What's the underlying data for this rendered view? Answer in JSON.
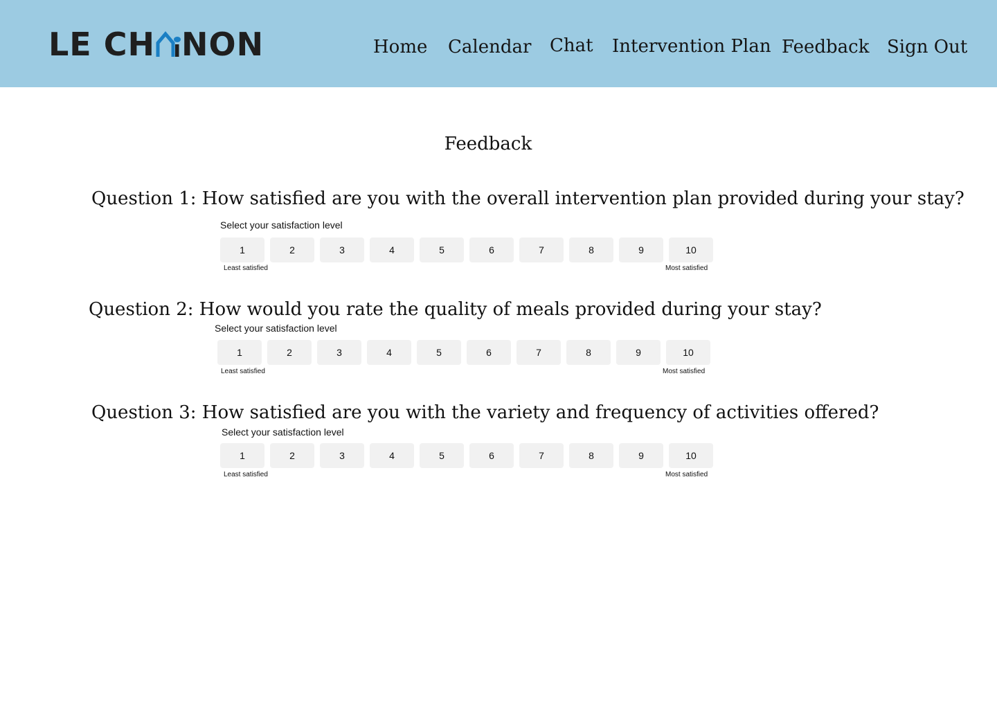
{
  "brand": {
    "logo_left": "LE CH",
    "logo_right": "NON",
    "accent": "#1a7fc4",
    "header_bg": "#9ccbe2"
  },
  "nav": {
    "items": [
      {
        "label": "Home"
      },
      {
        "label": "Calendar"
      },
      {
        "label": "Chat"
      },
      {
        "label": "Intervention Plan"
      },
      {
        "label": "Feedback"
      },
      {
        "label": "Sign Out"
      }
    ]
  },
  "page": {
    "title": "Feedback"
  },
  "questions": [
    {
      "text": "Question 1: How satisfied are you with the overall intervention plan provided during your stay?",
      "scale_label": "Select your satisfaction level",
      "options": [
        "1",
        "2",
        "3",
        "4",
        "5",
        "6",
        "7",
        "8",
        "9",
        "10"
      ],
      "min_label": "Least satisfied",
      "max_label": "Most satisfied"
    },
    {
      "text": "Question 2: How would you rate the quality of meals provided during your stay?",
      "scale_label": "Select your satisfaction level",
      "options": [
        "1",
        "2",
        "3",
        "4",
        "5",
        "6",
        "7",
        "8",
        "9",
        "10"
      ],
      "min_label": "Least satisfied",
      "max_label": "Most satisfied"
    },
    {
      "text": "Question 3: How satisfied are you with the variety and frequency of activities offered?",
      "scale_label": "Select your satisfaction level",
      "options": [
        "1",
        "2",
        "3",
        "4",
        "5",
        "6",
        "7",
        "8",
        "9",
        "10"
      ],
      "min_label": "Least satisfied",
      "max_label": "Most satisfied"
    }
  ]
}
